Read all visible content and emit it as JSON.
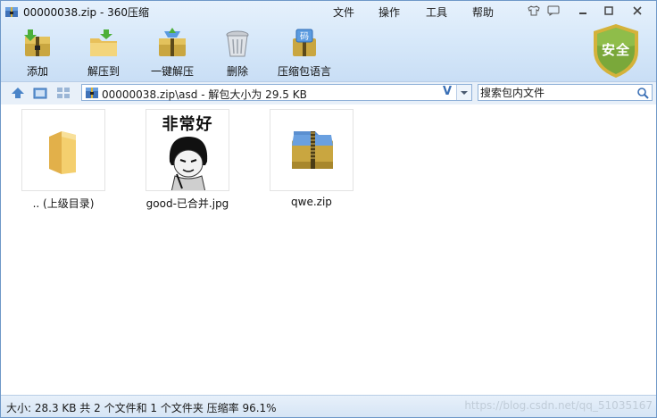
{
  "window": {
    "title": "00000038.zip - 360压缩",
    "menu": [
      "文件",
      "操作",
      "工具",
      "帮助"
    ]
  },
  "toolbar": {
    "items": [
      {
        "label": "添加",
        "icon": "add-archive-icon"
      },
      {
        "label": "解压到",
        "icon": "extract-folder-icon"
      },
      {
        "label": "一键解压",
        "icon": "one-click-extract-icon"
      },
      {
        "label": "删除",
        "icon": "trash-icon"
      },
      {
        "label": "压缩包语言",
        "icon": "archive-language-icon"
      }
    ],
    "security_badge": "安全"
  },
  "address": {
    "path": "00000038.zip\\asd - 解包大小为 29.5 KB",
    "v_mark": "V"
  },
  "search": {
    "placeholder": "搜索包内文件"
  },
  "files": [
    {
      "name": ".. (上级目录)",
      "icon": "folder-icon"
    },
    {
      "name": "good-已合并.jpg",
      "icon": "image-thumbnail",
      "thumb_text": "非常好"
    },
    {
      "name": "qwe.zip",
      "icon": "zip-archive-icon"
    }
  ],
  "status": {
    "text": "大小: 28.3 KB 共 2 个文件和 1 个文件夹 压缩率 96.1%",
    "watermark": "https://blog.csdn.net/qq_51035167"
  },
  "colors": {
    "toolbar_bg": "#d5e7f9",
    "accent_blue": "#3a6fb5",
    "shield_green": "#7aa83a",
    "shield_gold": "#d4b23a"
  }
}
